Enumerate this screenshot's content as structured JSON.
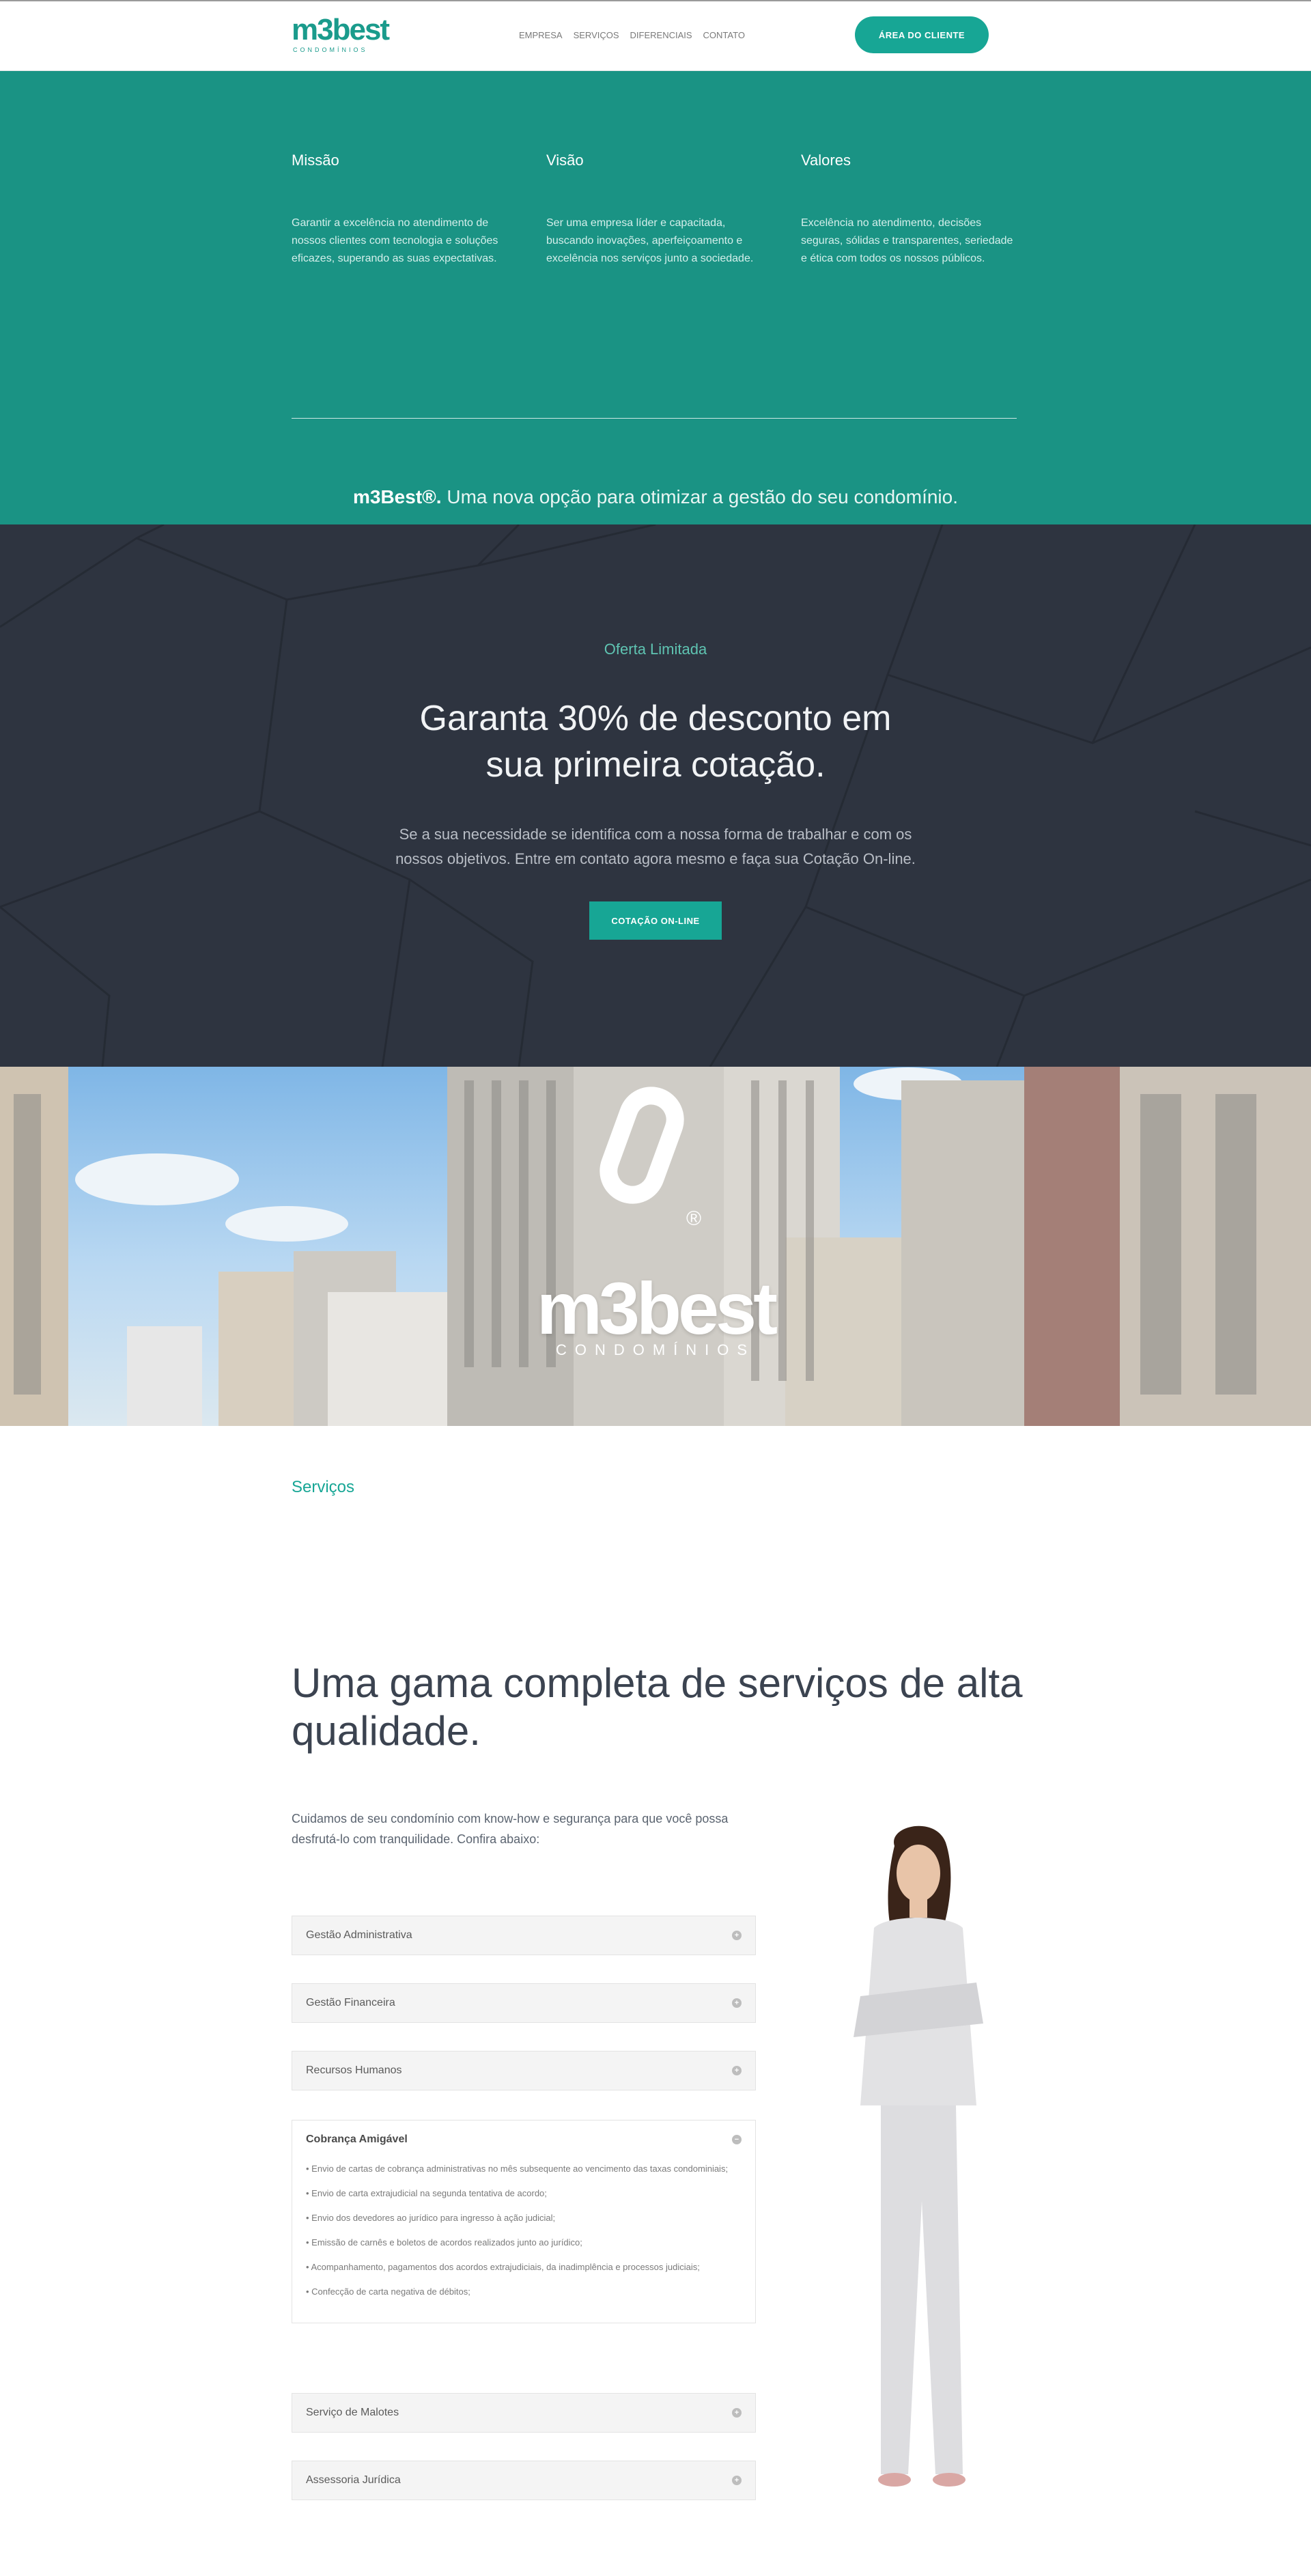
{
  "header": {
    "logo_main": "m3best",
    "logo_sub": "CONDOMÍNIOS",
    "nav": [
      "EMPRESA",
      "SERVIÇOS",
      "DIFERENCIAIS",
      "CONTATO"
    ],
    "client_button": "ÁREA DO CLIENTE"
  },
  "mission": {
    "columns": [
      {
        "title": "Missão",
        "text": "Garantir a excelência no atendimento de nossos clientes com tecnologia e soluções eficazes, superando as suas expectativas."
      },
      {
        "title": "Visão",
        "text": "Ser uma empresa líder e capacitada, buscando inovações, aperfeiçoamento e excelência nos serviços junto a sociedade."
      },
      {
        "title": "Valores",
        "text": "Excelência no atendimento, decisões seguras, sólidas e transparentes, seriedade e ética com todos os nossos públicos."
      }
    ],
    "tagline_brand": "m3Best®.",
    "tagline_text": " Uma nova opção para otimizar a gestão do seu condomínio."
  },
  "offer": {
    "eyebrow": "Oferta Limitada",
    "title": "Garanta 30% de desconto em sua primeira cotação.",
    "text": "Se a sua necessidade se identifica com a nossa forma de trabalhar e com os nossos objetivos. Entre em contato agora mesmo e faça sua Cotação On-line.",
    "button": "COTAÇÃO ON-LINE"
  },
  "banner": {
    "logo_main": "m3best",
    "logo_sub": "CONDOMÍNIOS"
  },
  "services": {
    "eyebrow": "Serviços",
    "title": "Uma gama completa de serviços de alta qualidade.",
    "intro": "Cuidamos de seu condomínio com know-how e segurança para que você possa desfrutá-lo com tranquilidade. Confira abaixo:",
    "items": [
      {
        "label": "Gestão Administrativa"
      },
      {
        "label": "Gestão Financeira"
      },
      {
        "label": "Recursos Humanos"
      },
      {
        "label": "Cobrança Amigável",
        "details": [
          "• Envio de cartas de cobrança administrativas no mês subsequente ao vencimento das taxas condominiais;",
          "• Envio de carta extrajudicial na segunda tentativa de acordo;",
          "• Envio dos devedores ao jurídico para ingresso à ação judicial;",
          "• Emissão de carnês e boletos de acordos realizados junto ao jurídico;",
          "• Acompanhamento, pagamentos dos acordos extrajudiciais, da inadimplência e processos judiciais;",
          "• Confecção de carta negativa de débitos;"
        ]
      },
      {
        "label": "Serviço de Malotes"
      },
      {
        "label": "Assessoria Jurídica"
      }
    ]
  },
  "colors": {
    "accent": "#17a695",
    "mission_bg": "#1a9384",
    "offer_bg": "#2e3440"
  }
}
